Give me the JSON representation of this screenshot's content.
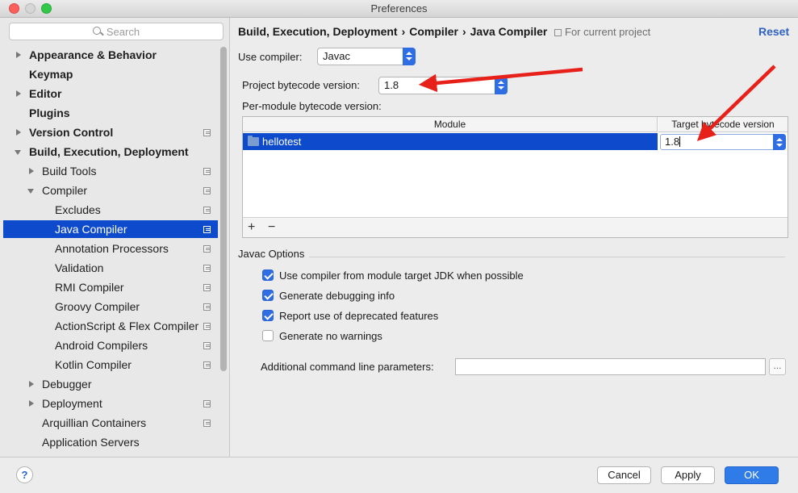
{
  "window": {
    "title": "Preferences"
  },
  "search": {
    "placeholder": "Search"
  },
  "sidebar": {
    "items": [
      {
        "label": "Appearance & Behavior"
      },
      {
        "label": "Keymap"
      },
      {
        "label": "Editor"
      },
      {
        "label": "Plugins"
      },
      {
        "label": "Version Control"
      },
      {
        "label": "Build, Execution, Deployment"
      },
      {
        "label": "Build Tools"
      },
      {
        "label": "Compiler"
      },
      {
        "label": "Excludes"
      },
      {
        "label": "Java Compiler"
      },
      {
        "label": "Annotation Processors"
      },
      {
        "label": "Validation"
      },
      {
        "label": "RMI Compiler"
      },
      {
        "label": "Groovy Compiler"
      },
      {
        "label": "ActionScript & Flex Compiler"
      },
      {
        "label": "Android Compilers"
      },
      {
        "label": "Kotlin Compiler"
      },
      {
        "label": "Debugger"
      },
      {
        "label": "Deployment"
      },
      {
        "label": "Arquillian Containers"
      },
      {
        "label": "Application Servers"
      }
    ]
  },
  "breadcrumb": {
    "parts": [
      "Build, Execution, Deployment",
      "Compiler",
      "Java Compiler"
    ],
    "separator": "›",
    "scope": "For current project",
    "reset": "Reset"
  },
  "settings": {
    "use_compiler_label": "Use compiler:",
    "use_compiler_value": "Javac",
    "project_bytecode_label": "Project bytecode version:",
    "project_bytecode_value": "1.8",
    "per_module_label": "Per-module bytecode version:"
  },
  "module_table": {
    "columns": [
      "Module",
      "Target bytecode version"
    ],
    "rows": [
      {
        "module": "hellotest",
        "target": "1.8"
      }
    ],
    "add": "+",
    "remove": "−"
  },
  "javac_options": {
    "title": "Javac Options",
    "checkboxes": [
      {
        "label": "Use compiler from module target JDK when possible",
        "checked": true
      },
      {
        "label": "Generate debugging info",
        "checked": true
      },
      {
        "label": "Report use of deprecated features",
        "checked": true
      },
      {
        "label": "Generate no warnings",
        "checked": false
      }
    ],
    "additional_params_label": "Additional command line parameters:",
    "additional_params_value": "",
    "ellipsis": "..."
  },
  "footer": {
    "help": "?",
    "cancel": "Cancel",
    "apply": "Apply",
    "ok": "OK"
  },
  "colors": {
    "selection": "#0e4bcc",
    "accent": "#2f6de5",
    "annotation_arrow": "#e8201a"
  }
}
